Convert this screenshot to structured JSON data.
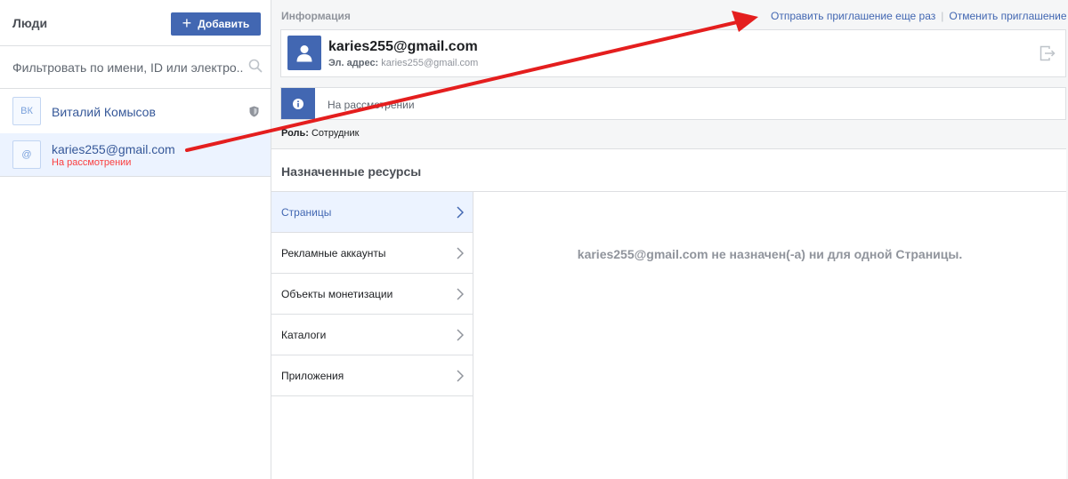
{
  "people_panel": {
    "title": "Люди",
    "add_button": "Добавить",
    "filter_placeholder": "Фильтровать по имени, ID или электро...",
    "people": [
      {
        "avatar": "ВК",
        "name": "Виталий Комысов",
        "status": "",
        "icon": "shield-icon"
      },
      {
        "avatar": "@",
        "name": "karies255@gmail.com",
        "status": "На рассмотрении"
      }
    ]
  },
  "info": {
    "section_label": "Информация",
    "resend_link": "Отправить приглашение еще раз",
    "cancel_link": "Отменить приглашение",
    "email_title": "karies255@gmail.com",
    "email_label": "Эл. адрес:",
    "email_value": "karies255@gmail.com",
    "status_text": "На рассмотрении",
    "role_label": "Роль:",
    "role_value": "Сотрудник"
  },
  "resources": {
    "title": "Назначенные ресурсы",
    "tabs": [
      {
        "label": "Страницы",
        "active": true
      },
      {
        "label": "Рекламные аккаунты",
        "active": false
      },
      {
        "label": "Объекты монетизации",
        "active": false
      },
      {
        "label": "Каталоги",
        "active": false
      },
      {
        "label": "Приложения",
        "active": false
      }
    ],
    "empty_message": "karies255@gmail.com не назначен(-а) ни для одной Страницы."
  },
  "colors": {
    "accent": "#4267b2",
    "annotation_arrow": "#e41e1e",
    "pending_status": "#fa3e3e"
  }
}
